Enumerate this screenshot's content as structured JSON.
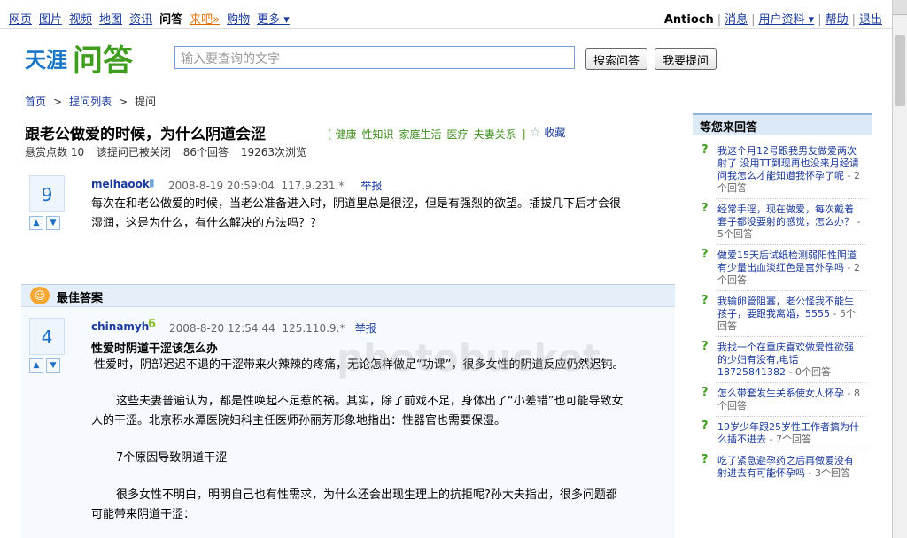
{
  "topnav": [
    "网页",
    "图片",
    "视频",
    "地图",
    "资讯",
    "问答",
    "来吧»",
    "购物",
    "更多 ▾"
  ],
  "topright": {
    "user": "Antioch",
    "links": [
      "消息",
      "用户资料 ▾",
      "帮助",
      "退出"
    ]
  },
  "logo": {
    "text1": "天涯",
    "text2": "问答"
  },
  "search": {
    "placeholder": "输入要查询的文字",
    "btn_search": "搜索问答",
    "btn_ask": "我要提问"
  },
  "breadcrumb": [
    "首页",
    "提问列表",
    "提问"
  ],
  "question": {
    "title": "跟老公做爱的时候，为什么阴道会涩",
    "tags": [
      "健康",
      "性知识",
      "家庭生活",
      "医疗",
      "夫妻关系"
    ],
    "fav": "收藏",
    "meta": [
      "悬赏点数 10",
      "该提问已被关闭",
      "86个回答",
      "19263次浏览"
    ],
    "votes": "9",
    "author": "meihaook",
    "date": "2008-8-19 20:59:04",
    "ip": "117.9.231.*",
    "report": "举报",
    "text1": "每次在和老公做爱的时候，当老公准备进入时，阴道里总是很涩，但是有强烈的欲望。插拔几下后才会很",
    "text2": "湿润，这是为什么，有什么解决的方法吗？？"
  },
  "best": {
    "label": "最佳答案",
    "votes": "4",
    "author": "chinamyh",
    "date": "2008-8-20 12:54:44",
    "ip": "125.110.9.*",
    "report": "举报",
    "title": "性爱时阴道干涩该怎么办",
    "p1": "性爱时，阴部迟迟不退的干涩带来火辣辣的疼痛，无论怎样做足“功课”，很多女性的阴道反应仍然迟钝。",
    "p2a": "这些夫妻普遍认为，都是性唤起不足惹的祸。其实，除了前戏不足，身体出了“小差错”也可能导致女",
    "p2b": "人的干涩。北京积水潭医院妇科主任医师孙丽芳形象地指出：性器官也需要保湿。",
    "p3": "7个原因导致阴道干涩",
    "p4a": "很多女性不明白，明明自己也有性需求，为什么还会出现生理上的抗拒呢?孙大夫指出，很多问题都",
    "p4b": "可能带来阴道干涩："
  },
  "sidebar": {
    "title": "等您来回答",
    "items": [
      {
        "text": "我这个月12号跟我男友做爱两次射了 没用TT到现再也没来月经请问我怎么才能知道我怀孕了呢",
        "count": "- 2个回答"
      },
      {
        "text": "经常手淫，现在做爱，每次戴着套子都没要射的感觉，怎么办？",
        "count": "- 5个回答"
      },
      {
        "text": "做爱15天后试纸检测弱阳性阴道有少量出血淡红色是宫外孕吗",
        "count": "- 2个回答"
      },
      {
        "text": "我输卵管阻塞，老公怪我不能生孩子，要跟我离婚，5555",
        "count": "- 5个回答"
      },
      {
        "text": "我找一个在重庆喜欢做爱性欲强的少妇有没有,电话18725841382",
        "count": "- 0个回答"
      },
      {
        "text": "怎么带套发生关系使女人怀孕",
        "count": "- 8个回答"
      },
      {
        "text": "19岁少年跟25岁性工作者搞为什么插不进去",
        "count": "- 7个回答"
      },
      {
        "text": "吃了紧急避孕药之后再做爱没有射进去有可能怀孕吗",
        "count": "- 3个回答"
      }
    ]
  },
  "watermark": "photobucket"
}
